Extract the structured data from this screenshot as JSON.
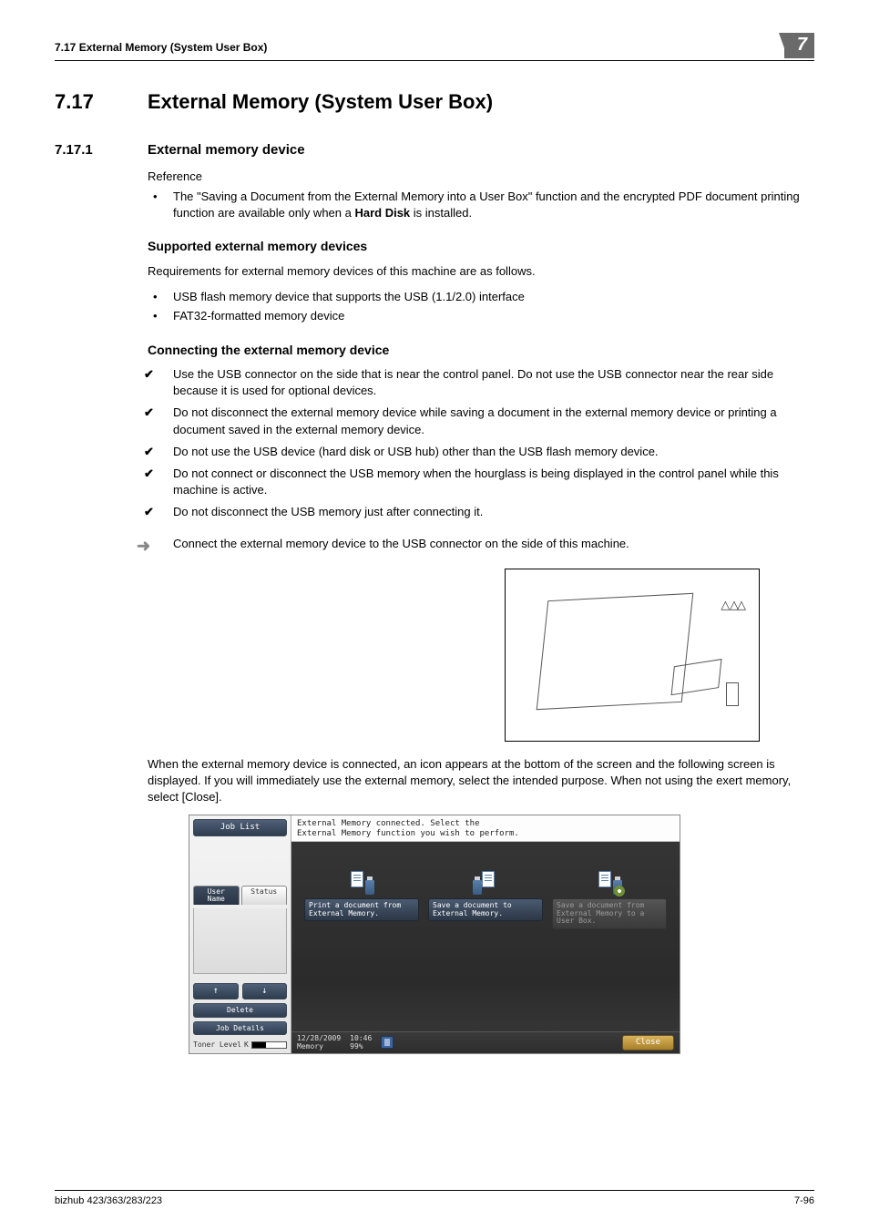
{
  "header": {
    "left": "7.17    External Memory (System User Box)",
    "chapter": "7"
  },
  "h1": {
    "num": "7.17",
    "title": "External Memory (System User Box)"
  },
  "h2": {
    "num": "7.17.1",
    "title": "External memory device"
  },
  "reference_label": "Reference",
  "reference_bullet_1a": "The \"Saving a Document from the External Memory into a User Box\" function and the encrypted PDF document printing function are available only when a ",
  "reference_bullet_1b_bold": "Hard Disk",
  "reference_bullet_1c": " is installed.",
  "h3_supported": "Supported external memory devices",
  "supported_intro": "Requirements for external memory devices of this machine are as follows.",
  "supported_bullets": {
    "b1": "USB flash memory device that supports the USB (1.1/2.0) interface",
    "b2": "FAT32-formatted memory device"
  },
  "h3_connecting": "Connecting the external memory device",
  "connect_checks": {
    "c1": "Use the USB connector on the side that is near the control panel. Do not use the USB connector near the rear side because it is used for optional devices.",
    "c2": "Do not disconnect the external memory device while saving a document in the external memory device or printing a document saved in the external memory device.",
    "c3": "Do not use the USB device (hard disk or USB hub) other than the USB flash memory device.",
    "c4": "Do not connect or disconnect the USB memory when the hourglass is being displayed in the control panel while this machine is active.",
    "c5": "Do not disconnect the USB memory just after connecting it."
  },
  "connect_action": "Connect the external memory device to the USB connector on the side of this machine.",
  "printer_triangles": "△ △△",
  "after_para": "When the external memory device is connected, an icon appears at the bottom of the screen and the following screen is displayed. If you will immediately use the external memory, select the intended purpose. When not using the exert memory, select [Close].",
  "screenshot": {
    "left": {
      "job_list": "Job List",
      "tab_user": "User\nName",
      "tab_status": "Status",
      "up": "↑",
      "down": "↓",
      "delete": "Delete",
      "job_details": "Job Details",
      "toner_label": "Toner Level",
      "toner_letter": "K"
    },
    "msg_line1": "External Memory connected.  Select the",
    "msg_line2": "External Memory function you wish to perform.",
    "opts": {
      "o1": "Print a document from External Memory.",
      "o2": "Save a document to External Memory.",
      "o3": "Save a document from External Memory to a User Box."
    },
    "footer": {
      "date": "12/28/2009",
      "time": "10:46",
      "memory_label": "Memory",
      "memory_pct": "99%",
      "close": "Close"
    }
  },
  "footer": {
    "left": "bizhub 423/363/283/223",
    "right": "7-96"
  }
}
